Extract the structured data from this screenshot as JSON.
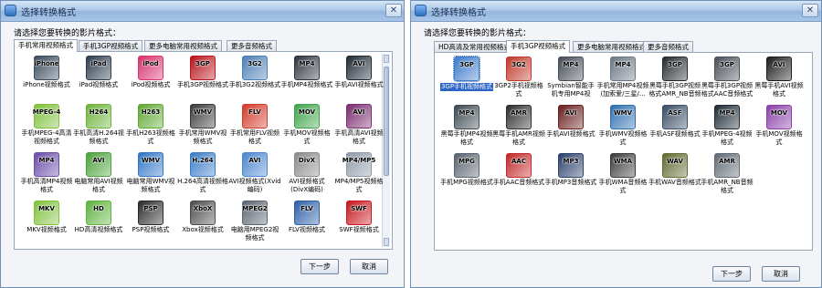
{
  "left_dialog": {
    "title": "选择转换格式",
    "prompt": "请选择您要转换的影片格式：",
    "tabs": [
      "手机常用视频格式",
      "手机3GP视频格式",
      "更多电脑常用视频格式",
      "更多音频格式"
    ],
    "active_tab": 0,
    "items": [
      {
        "label": "iPhone视频格式",
        "icon_text": "iPhone",
        "icon": "iphone-icon",
        "color": "#3b4a5c"
      },
      {
        "label": "iPad视频格式",
        "icon_text": "iPad",
        "icon": "ipad-icon",
        "color": "#2f3c4c"
      },
      {
        "label": "iPod视频格式",
        "icon_text": "iPod",
        "icon": "ipod-icon",
        "color": "#d8326f"
      },
      {
        "label": "手机3GP视频格式",
        "icon_text": "3GP",
        "icon": "phone-3gp-icon",
        "color": "#b8151c"
      },
      {
        "label": "手机3G2视频格式",
        "icon_text": "3G2",
        "icon": "phone-3g2-icon",
        "color": "#4c7fb5"
      },
      {
        "label": "手机MP4视频格式",
        "icon_text": "MP4",
        "icon": "phone-mp4-icon",
        "color": "#2e3440"
      },
      {
        "label": "手机AVI视频格式",
        "icon_text": "AVI",
        "icon": "phone-avi-icon",
        "color": "#1f2a36"
      },
      {
        "label": "手机MPEG-4高清视频格式",
        "icon_text": "MPEG-4",
        "icon": "android-mpeg4-icon",
        "color": "#7fbf3a"
      },
      {
        "label": "手机高清H.264视频格式",
        "icon_text": "H264",
        "icon": "android-h264-icon",
        "color": "#6db23a"
      },
      {
        "label": "手机H263视频格式",
        "icon_text": "H263",
        "icon": "android-h263-icon",
        "color": "#5ea831"
      },
      {
        "label": "手机常用WMV视频格式",
        "icon_text": "WMV",
        "icon": "phone-wmv-icon",
        "color": "#3a3a3a"
      },
      {
        "label": "手机常用FLV视频格式",
        "icon_text": "FLV",
        "icon": "phone-flv-icon",
        "color": "#d23a2a"
      },
      {
        "label": "手机MOV视频格式",
        "icon_text": "MOV",
        "icon": "phone-mov-icon",
        "color": "#3fa34a"
      },
      {
        "label": "手机高清AVI视频格式",
        "icon_text": "AVI",
        "icon": "phone-hd-avi-icon",
        "color": "#7a2c6f"
      },
      {
        "label": "手机高清MP4视频格式",
        "icon_text": "MP4",
        "icon": "phone-hd-mp4-icon",
        "color": "#6a4ca8"
      },
      {
        "label": "电脑常用AVI视频格式",
        "icon_text": "AVI",
        "icon": "pc-avi-icon",
        "color": "#4ca23c"
      },
      {
        "label": "电脑常用WMV视频格式",
        "icon_text": "WMV",
        "icon": "pc-wmv-icon",
        "color": "#2f76c7"
      },
      {
        "label": "H.264高清视频格式",
        "icon_text": "H.264",
        "icon": "h264-hd-icon",
        "color": "#3a7cc6"
      },
      {
        "label": "AVI视频格式(Xvid编码)",
        "icon_text": "AVI",
        "icon": "avi-xvid-icon",
        "color": "#4b87d0"
      },
      {
        "label": "AVI视频格式(DivX编码)",
        "icon_text": "DivX",
        "icon": "avi-divx-icon",
        "color": "#8a8a8a"
      },
      {
        "label": "MP4/MP5视频格式",
        "icon_text": "MP4/MP5",
        "icon": "mp4-mp5-icon",
        "color": "#8e9aa8"
      },
      {
        "label": "MKV视频格式",
        "icon_text": "MKV",
        "icon": "mkv-icon",
        "color": "#7fc13c"
      },
      {
        "label": "HD高清视频格式",
        "icon_text": "HD",
        "icon": "hd-icon",
        "color": "#5fb33f"
      },
      {
        "label": "PSP视频格式",
        "icon_text": "PSP",
        "icon": "psp-icon",
        "color": "#2a2a2a"
      },
      {
        "label": "Xbox视频格式",
        "icon_text": "XboX",
        "icon": "xbox-icon",
        "color": "#4d4d4d"
      },
      {
        "label": "电脑用MPEG2视频格式",
        "icon_text": "MPEG2",
        "icon": "mpeg2-icon",
        "color": "#5a6470"
      },
      {
        "label": "FLV视频格式",
        "icon_text": "FLV",
        "icon": "flv-icon",
        "color": "#2d5fa6"
      },
      {
        "label": "SWF视频格式",
        "icon_text": "SWF",
        "icon": "swf-icon",
        "color": "#c8161d"
      }
    ],
    "next_button": "下一步",
    "cancel_button": "取消"
  },
  "right_dialog": {
    "title": "选择转换格式",
    "prompt": "请选择您要转换的影片格式：",
    "tabs": [
      "HD高清及常用视频格式",
      "手机3GP视频格式",
      "更多电脑常用视频格式",
      "更多音频格式"
    ],
    "active_tab": 1,
    "selected_index": 0,
    "items": [
      {
        "label": "3GP手机视频格式",
        "icon_text": "3GP",
        "icon": "phone-3gp-icon",
        "color": "#3d7cc9"
      },
      {
        "label": "3GP2手机视频格式",
        "icon_text": "3G2",
        "icon": "phone-3gp2-icon",
        "color": "#c0392b"
      },
      {
        "label": "Symbian智能手机专用MP4视",
        "icon_text": "MP4",
        "icon": "symbian-mp4-icon",
        "color": "#444c55"
      },
      {
        "label": "手机常用MP4视频(加索爱/三星/...",
        "icon_text": "MP4",
        "icon": "phone-mp4-icon",
        "color": "#6b7785"
      },
      {
        "label": "黑莓手机3GP视频格式AMR_NB音频格式",
        "icon_text": "3GP",
        "icon": "blackberry-3gp-amr-icon",
        "color": "#262a2f"
      },
      {
        "label": "黑莓手机3GP视频格式AAC音频格式",
        "icon_text": "3GP",
        "icon": "blackberry-3gp-aac-icon",
        "color": "#4a5058"
      },
      {
        "label": "黑莓手机AVI视频格式",
        "icon_text": "AVI",
        "icon": "blackberry-avi-icon",
        "color": "#1d1d1d"
      },
      {
        "label": "黑莓手机MP4视频格式",
        "icon_text": "MP4",
        "icon": "blackberry-mp4-icon",
        "color": "#3d4a52"
      },
      {
        "label": "黑莓手机AMR视频格式",
        "icon_text": "AMR",
        "icon": "blackberry-amr-icon",
        "color": "#2d2d2d"
      },
      {
        "label": "手机AVI视频格式",
        "icon_text": "AVI",
        "icon": "phone-avi-icon",
        "color": "#6a1e1e"
      },
      {
        "label": "手机WMV视频格式",
        "icon_text": "WMV",
        "icon": "phone-wmv-icon",
        "color": "#2e6fb0"
      },
      {
        "label": "手机ASF视频格式",
        "icon_text": "ASF",
        "icon": "phone-asf-icon",
        "color": "#394d66"
      },
      {
        "label": "手机MPEG-4视频格式",
        "icon_text": "MP4",
        "icon": "phone-mpeg4-icon",
        "color": "#1e2a35"
      },
      {
        "label": "手机MOV视频格式",
        "icon_text": "MOV",
        "icon": "phone-mov-icon",
        "color": "#8a3fa8"
      },
      {
        "label": "手机MPG视频格式",
        "icon_text": "MPG",
        "icon": "phone-mpg-icon",
        "color": "#58636f"
      },
      {
        "label": "手机AAC音频格式",
        "icon_text": "AAC",
        "icon": "phone-aac-icon",
        "color": "#c12828"
      },
      {
        "label": "手机MP3音频格式",
        "icon_text": "MP3",
        "icon": "phone-mp3-icon",
        "color": "#2a3f6a"
      },
      {
        "label": "手机WMA音频格式",
        "icon_text": "WMA",
        "icon": "phone-wma-icon",
        "color": "#3c3c3c"
      },
      {
        "label": "手机WAV音频格式",
        "icon_text": "WAV",
        "icon": "phone-wav-icon",
        "color": "#5f6b2f"
      },
      {
        "label": "手机AMR_NB音频格式",
        "icon_text": "AMR",
        "icon": "phone-amr-icon",
        "color": "#606a74"
      }
    ],
    "next_button": "下一步",
    "cancel_button": "取消"
  },
  "close_glyph": "✕"
}
